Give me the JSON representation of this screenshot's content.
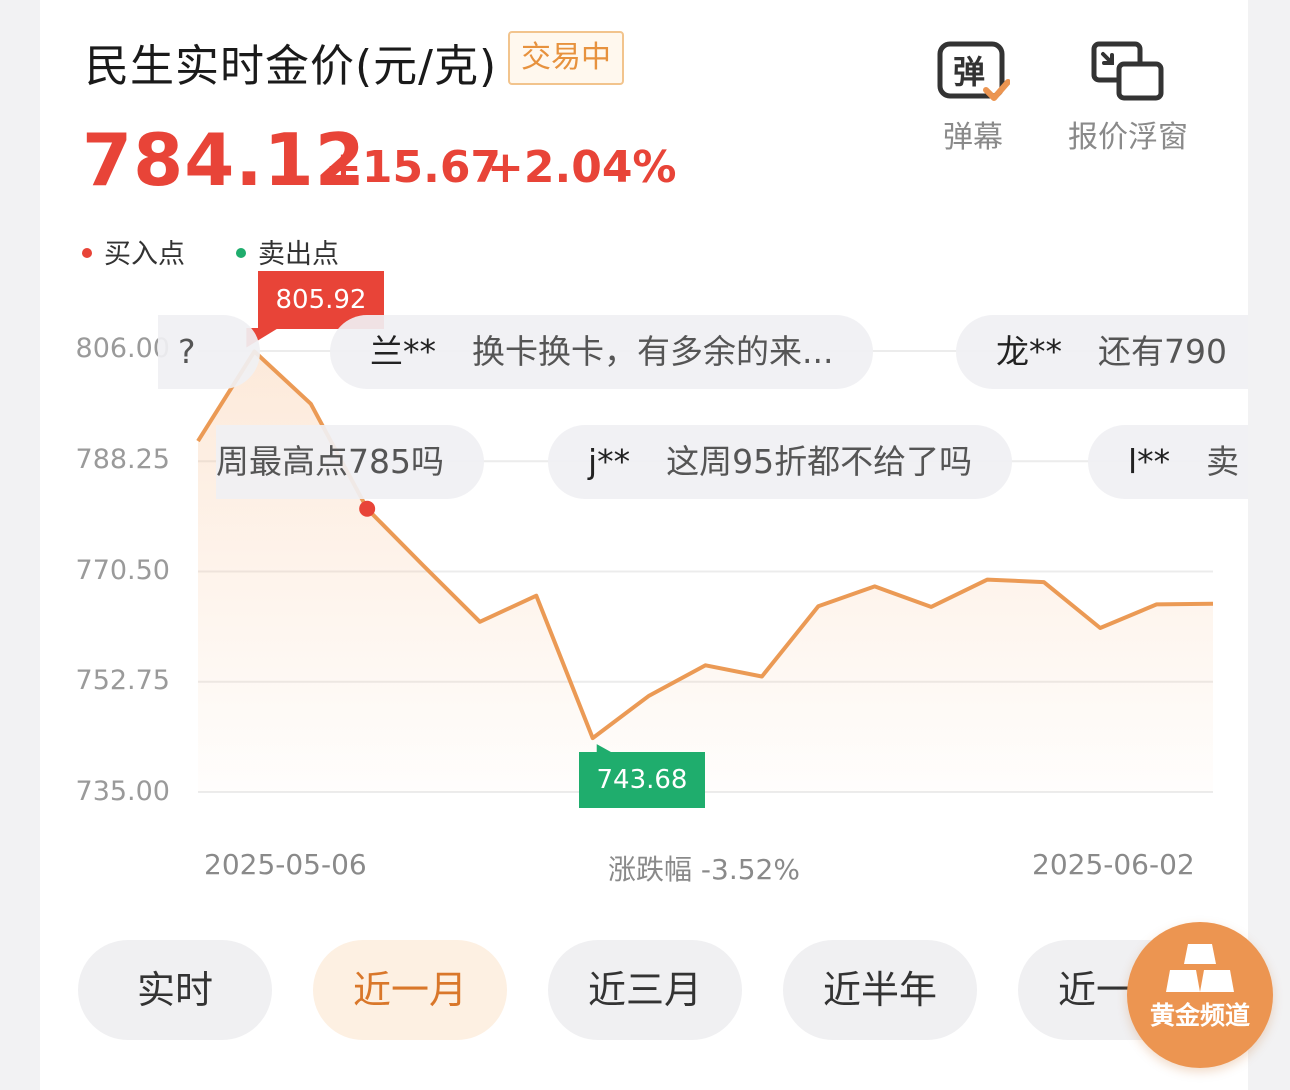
{
  "header": {
    "title": "民生实时金价(元/克)",
    "status_badge": "交易中",
    "price": "784.12",
    "change_abs": "+15.67",
    "change_pct": "+2.04%"
  },
  "toolbar": {
    "danmaku_icon_text": "弹",
    "danmaku_label": "弹幕",
    "float_label": "报价浮窗"
  },
  "legend": {
    "buy": "买入点",
    "sell": "卖出点"
  },
  "colors": {
    "up": "#e84438",
    "down": "#1fad6d",
    "line": "#eb9a55",
    "accent": "#ec9551"
  },
  "chart_data": {
    "type": "area",
    "y_ticks": [
      "806.00",
      "788.25",
      "770.50",
      "752.75",
      "735.00"
    ],
    "ylim": [
      735.0,
      806.0
    ],
    "values": [
      791.5,
      805.92,
      797.5,
      780.6,
      771.4,
      762.4,
      766.6,
      743.68,
      750.5,
      755.4,
      753.6,
      764.9,
      768.1,
      764.8,
      769.2,
      768.8,
      761.4,
      765.2,
      765.3
    ],
    "x_start": "2025-05-06",
    "x_end": "2025-06-02",
    "max_label": "805.92",
    "min_label": "743.68",
    "buy_point_index": 3,
    "range_label": "涨跌幅 -3.52%",
    "icons": {
      "buy_marker": "red-dot"
    }
  },
  "danmaku": [
    {
      "nick": "?",
      "text": ""
    },
    {
      "nick": "兰**",
      "text": "换卡换卡，有多余的来..."
    },
    {
      "nick": "龙**",
      "text": "还有790"
    },
    {
      "nick": "",
      "text": "周最高点785吗"
    },
    {
      "nick": "j**",
      "text": "这周95折都不给了吗"
    },
    {
      "nick": "l**",
      "text": "卖"
    }
  ],
  "tabs": [
    "实时",
    "近一月",
    "近三月",
    "近半年",
    "近一年"
  ],
  "active_tab": 1,
  "fab": {
    "label": "黄金频道",
    "icon": "gold-bars-icon"
  }
}
